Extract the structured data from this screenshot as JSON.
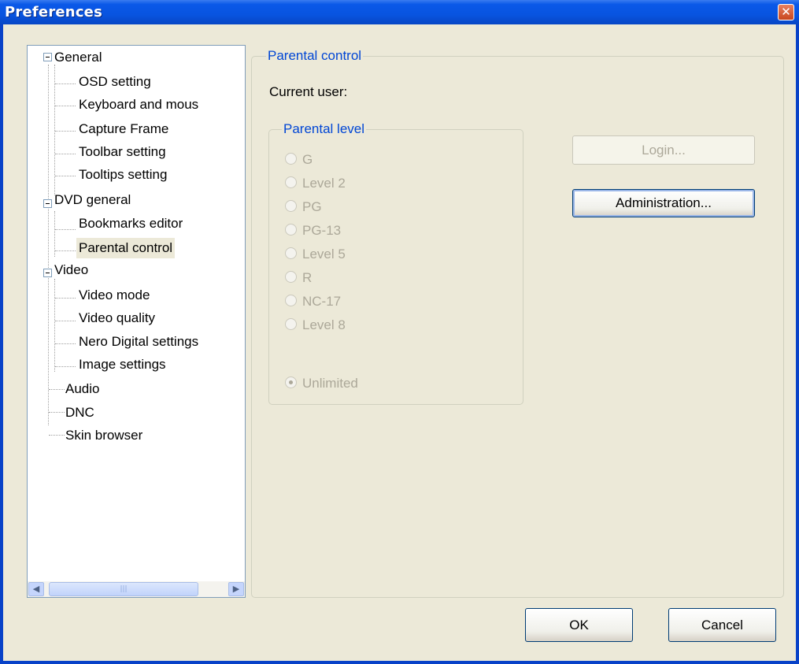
{
  "window": {
    "title": "Preferences",
    "close_glyph": "✕"
  },
  "tree": {
    "nodes": [
      {
        "label": "General",
        "expandable": true
      },
      {
        "label": "OSD setting"
      },
      {
        "label": "Keyboard and mous"
      },
      {
        "label": "Capture Frame"
      },
      {
        "label": "Toolbar setting"
      },
      {
        "label": "Tooltips setting"
      },
      {
        "label": "DVD general",
        "expandable": true
      },
      {
        "label": "Bookmarks editor"
      },
      {
        "label": "Parental control",
        "selected": true
      },
      {
        "label": "Video",
        "expandable": true
      },
      {
        "label": "Video mode"
      },
      {
        "label": "Video quality"
      },
      {
        "label": "Nero Digital settings"
      },
      {
        "label": "Image settings"
      },
      {
        "label": "Audio"
      },
      {
        "label": "DNC"
      },
      {
        "label": "Skin browser"
      }
    ],
    "scroll_left_glyph": "◀",
    "scroll_right_glyph": "▶",
    "scroll_thumb_glyph": "|||"
  },
  "parental": {
    "group_title": "Parental control",
    "current_user_label": "Current user:",
    "level_group_title": "Parental level",
    "levels": [
      "G",
      "Level 2",
      "PG",
      "PG-13",
      "Level 5",
      "R",
      "NC-17",
      "Level 8"
    ],
    "unlimited_label": "Unlimited",
    "selected_level": "Unlimited",
    "login_button": "Login...",
    "admin_button": "Administration..."
  },
  "footer": {
    "ok_button": "OK",
    "cancel_button": "Cancel"
  }
}
